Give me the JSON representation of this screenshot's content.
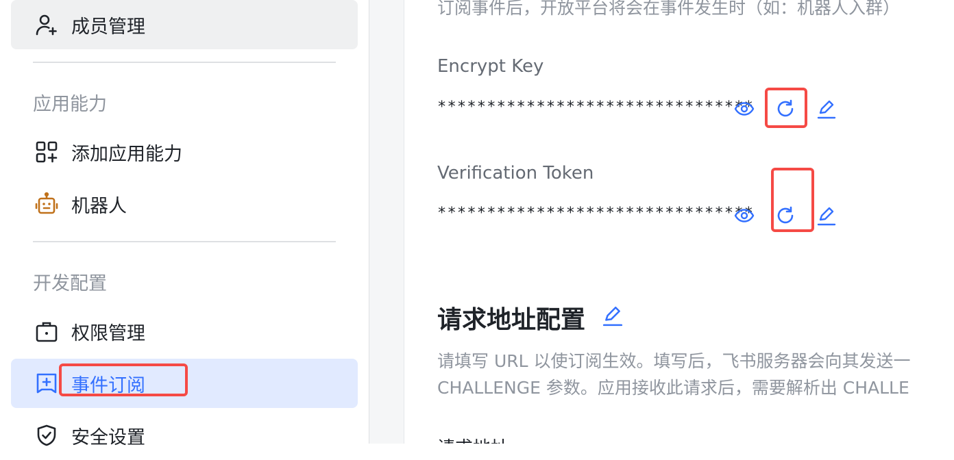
{
  "sidebar": {
    "member_management": "成员管理",
    "group_app_capability": "应用能力",
    "add_app_capability": "添加应用能力",
    "bot": "机器人",
    "group_dev_config": "开发配置",
    "permission_management": "权限管理",
    "event_subscription": "事件订阅",
    "security_settings": "安全设置"
  },
  "main": {
    "intro_text": "订阅事件后，开放平台将会在事件发生时（如：机器人入群）",
    "encrypt_key": {
      "label": "Encrypt Key",
      "value": "********************************"
    },
    "verification_token": {
      "label": "Verification Token",
      "value": "********************************"
    },
    "request_url": {
      "title": "请求地址配置",
      "desc_line1": "请填写 URL 以使订阅生效。填写后，飞书服务器会向其发送一",
      "desc_line2": "CHALLENGE 参数。应用接收此请求后，需要解析出 CHALLE",
      "field_label": "请求地址"
    }
  },
  "colors": {
    "accent": "#3370ff",
    "active_bg": "#e1eaff",
    "highlight_border": "#f54a45",
    "bot_icon": "#c0711a"
  },
  "icons": [
    "user-add-icon",
    "apps-add-icon",
    "robot-icon",
    "briefcase-icon",
    "event-add-icon",
    "shield-check-icon",
    "eye-icon",
    "refresh-icon",
    "edit-icon"
  ]
}
